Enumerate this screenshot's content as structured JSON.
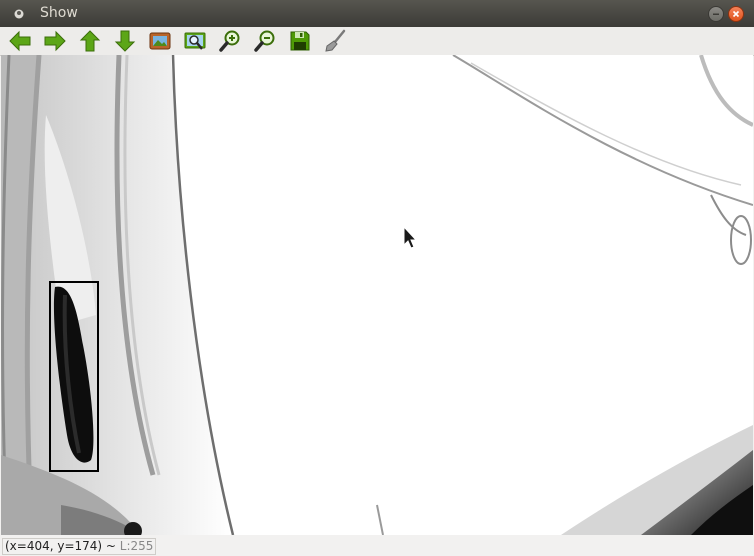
{
  "window": {
    "title": "Show"
  },
  "toolbar": {
    "buttons": [
      {
        "name": "pan-left-button",
        "icon": "arrow-left-icon"
      },
      {
        "name": "pan-right-button",
        "icon": "arrow-right-icon"
      },
      {
        "name": "pan-up-button",
        "icon": "arrow-up-icon"
      },
      {
        "name": "pan-down-button",
        "icon": "arrow-down-icon"
      },
      {
        "name": "zoom-reset-button",
        "icon": "image-icon"
      },
      {
        "name": "zoom-fit-button",
        "icon": "zoom-image-icon"
      },
      {
        "name": "zoom-in-button",
        "icon": "zoom-in-icon"
      },
      {
        "name": "zoom-out-button",
        "icon": "zoom-out-icon"
      },
      {
        "name": "save-button",
        "icon": "floppy-disk-icon"
      },
      {
        "name": "properties-button",
        "icon": "brush-icon"
      }
    ]
  },
  "status": {
    "coords": "(x=404, y=174) ~ ",
    "level": "L:255"
  },
  "colors": {
    "toolbar_green": "#4e9a06",
    "close_button": "#e95420"
  }
}
